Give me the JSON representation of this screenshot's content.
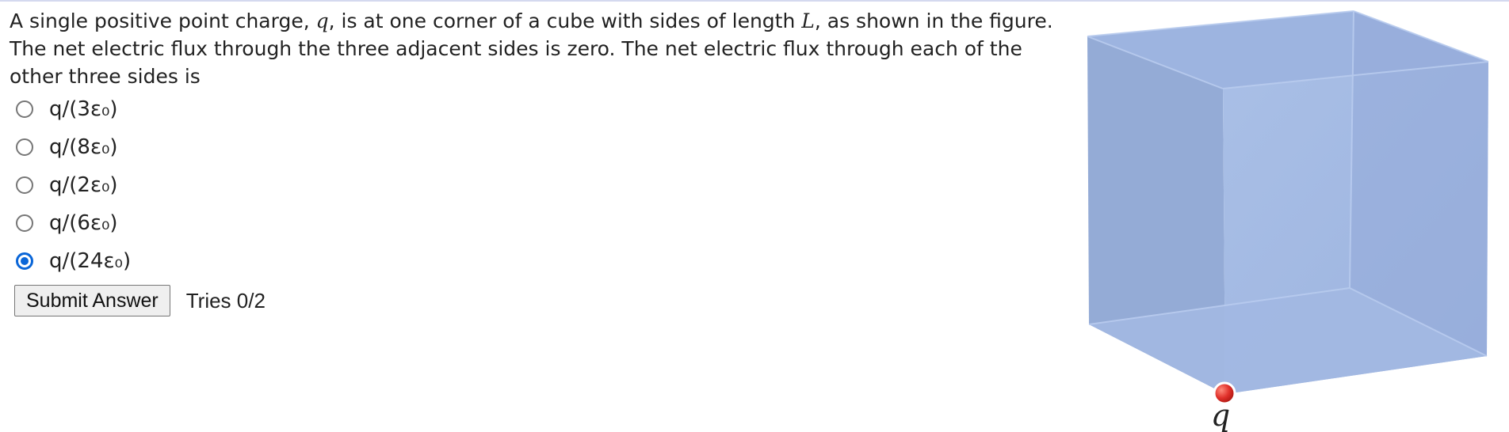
{
  "question": {
    "parts": [
      "A single positive point charge, ",
      "q",
      ", is at one corner of a cube with sides of length ",
      "L",
      ", as shown in the figure. The net electric flux through the three adjacent sides is zero. The net electric flux through each of the other three sides is"
    ]
  },
  "choices": [
    {
      "label": "q/(3ε₀)",
      "selected": false
    },
    {
      "label": "q/(8ε₀)",
      "selected": false
    },
    {
      "label": "q/(2ε₀)",
      "selected": false
    },
    {
      "label": "q/(6ε₀)",
      "selected": false
    },
    {
      "label": "q/(24ε₀)",
      "selected": true
    }
  ],
  "submit": {
    "label": "Submit Answer",
    "tries": "Tries 0/2"
  },
  "figure": {
    "charge_label": "q",
    "cube_color": "#9db3df",
    "charge_color": "#e0302a"
  }
}
